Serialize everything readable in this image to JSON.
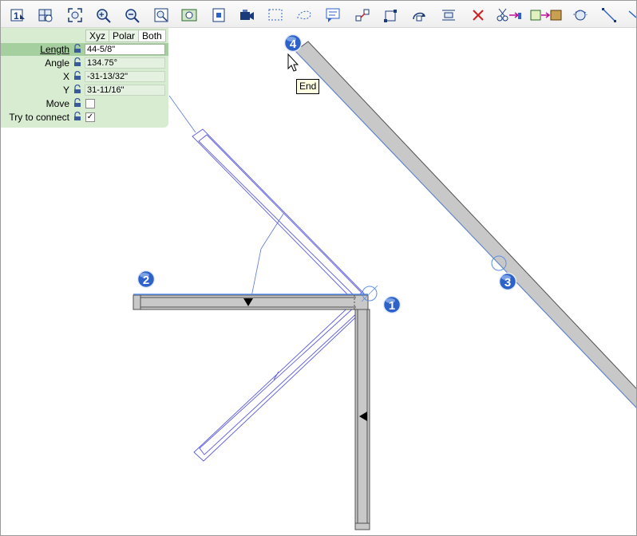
{
  "toolbar": {
    "tools": [
      {
        "name": "layer-1-icon",
        "label": "1"
      },
      {
        "name": "zoom-window-icon",
        "label": ""
      },
      {
        "name": "zoom-extents-icon",
        "label": ""
      },
      {
        "name": "zoom-in-icon",
        "label": "+"
      },
      {
        "name": "zoom-out-icon",
        "label": "−"
      },
      {
        "name": "zoom-selection-icon",
        "label": ""
      },
      {
        "name": "zoom-preview-icon",
        "label": ""
      },
      {
        "name": "view-frame-icon",
        "label": ""
      },
      {
        "name": "camera-view-icon",
        "label": ""
      },
      {
        "name": "select-rectangle-icon",
        "label": ""
      },
      {
        "name": "select-lasso-icon",
        "label": ""
      },
      {
        "name": "text-comment-icon",
        "label": ""
      },
      {
        "name": "connect-nodes-icon",
        "label": ""
      },
      {
        "name": "transform-nodes-icon",
        "label": ""
      },
      {
        "name": "rotate-icon",
        "label": ""
      },
      {
        "name": "align-icon",
        "label": ""
      },
      {
        "name": "delete-icon",
        "label": "✕"
      },
      {
        "name": "cut-icon",
        "label": "✂"
      },
      {
        "name": "move-component-icon",
        "label": ""
      },
      {
        "name": "copy-component-icon",
        "label": ""
      },
      {
        "name": "rotate-view-icon",
        "label": ""
      },
      {
        "name": "line-draw-icon",
        "label": ""
      },
      {
        "name": "more-icon",
        "label": ""
      }
    ]
  },
  "panel": {
    "tabs": [
      "Xyz",
      "Polar",
      "Both"
    ],
    "active_tab": "Both",
    "fields": [
      {
        "label": "Length",
        "value": "44-5/8\""
      },
      {
        "label": "Angle",
        "value": "134.75°"
      },
      {
        "label": "X",
        "value": "-31-13/32\""
      },
      {
        "label": "Y",
        "value": "31-11/16\""
      }
    ],
    "checks": [
      {
        "label": "Move",
        "checked": false,
        "mark": ""
      },
      {
        "label": "Try to connect",
        "checked": true,
        "mark": "✓"
      }
    ]
  },
  "markers": [
    "1",
    "2",
    "3",
    "4"
  ],
  "tooltip": "End",
  "colors": {
    "wall_fill": "#c8c8c8",
    "wall_edge": "#505050",
    "guide_blue": "#3c6ad6",
    "outline_blue": "#5a5ae6",
    "panel_bg": "#d8ecd2",
    "panel_highlight": "#a6cf9f",
    "marker_blue": "#2d62c8"
  }
}
